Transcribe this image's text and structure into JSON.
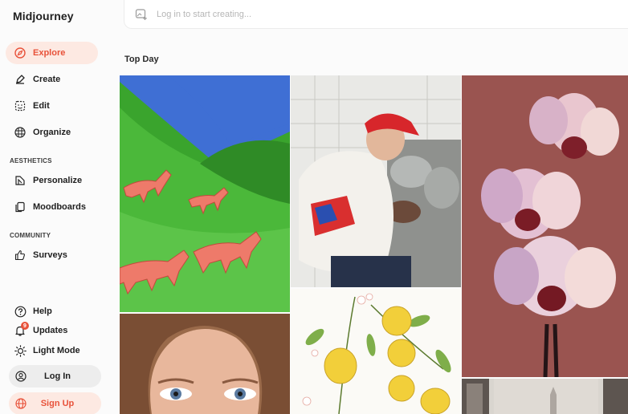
{
  "brand": "Midjourney",
  "nav": {
    "explore": "Explore",
    "create": "Create",
    "edit": "Edit",
    "organize": "Organize",
    "aesthetics_label": "AESTHETICS",
    "personalize": "Personalize",
    "moodboards": "Moodboards",
    "community_label": "COMMUNITY",
    "surveys": "Surveys"
  },
  "footer": {
    "help": "Help",
    "updates": "Updates",
    "updates_badge": "9",
    "light_mode": "Light Mode",
    "login": "Log In",
    "signup": "Sign Up"
  },
  "search": {
    "placeholder": "Log in to start creating..."
  },
  "feed": {
    "title": "Top Day"
  },
  "colors": {
    "accent": "#e8523a",
    "accent_bg": "#fde9e2"
  },
  "icons": [
    "compass-icon",
    "brush-icon",
    "edit-icon",
    "grid-icon",
    "personalize-icon",
    "moodboards-icon",
    "thumbs-up-icon",
    "help-icon",
    "bell-icon",
    "sun-icon",
    "user-icon",
    "globe-icon",
    "image-plus-icon"
  ]
}
